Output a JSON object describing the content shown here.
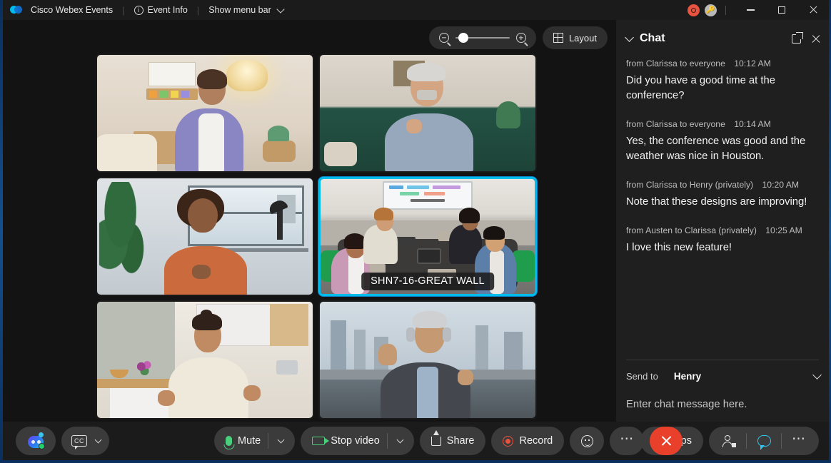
{
  "titlebar": {
    "app_name": "Cisco Webex Events",
    "event_info": "Event Info",
    "menu_bar": "Show menu bar",
    "recording_indicator": "recording-indicator",
    "host_key_indicator": "host-key-indicator",
    "minimize": "Minimize",
    "maximize": "Maximize",
    "close": "Close"
  },
  "stage": {
    "zoom_out_label": "Zoom out",
    "zoom_in_label": "Zoom in",
    "zoom_level": 12,
    "layout_label": "Layout",
    "tiles": [
      {
        "id": "tile-1",
        "name": "",
        "active": false,
        "scene": "bedroom-woman-purple"
      },
      {
        "id": "tile-2",
        "name": "",
        "active": false,
        "scene": "livingroom-man-gray-beard"
      },
      {
        "id": "tile-3",
        "name": "",
        "active": false,
        "scene": "office-woman-orange"
      },
      {
        "id": "tile-4",
        "name": "SHN7-16-GREAT WALL",
        "active": true,
        "scene": "conference-room-four-people"
      },
      {
        "id": "tile-5",
        "name": "",
        "active": false,
        "scene": "kitchen-woman-cream"
      },
      {
        "id": "tile-6",
        "name": "",
        "active": false,
        "scene": "city-man-headphones"
      }
    ]
  },
  "controls": {
    "assistant_label": "Webex AI Assistant",
    "captions_label": "CC",
    "mute": "Mute",
    "stop_video": "Stop video",
    "share": "Share",
    "record": "Record",
    "reactions_label": "Reactions",
    "more_label": "More options",
    "leave_label": "Leave meeting",
    "apps": "Apps",
    "participants_label": "Participants",
    "chat_label": "Chat",
    "more_right_label": "More options"
  },
  "chat": {
    "title": "Chat",
    "collapse_label": "Collapse",
    "popout_label": "Open in new window",
    "close_label": "Close chat",
    "messages": [
      {
        "meta": "from Clarissa to everyone",
        "time": "10:12 AM",
        "text": "Did you have a good time at the conference?"
      },
      {
        "meta": "from Clarissa to everyone",
        "time": "10:14 AM",
        "text": "Yes, the conference was good and the weather was nice in Houston."
      },
      {
        "meta": "from Clarissa to Henry (privately)",
        "time": "10:20 AM",
        "text": "Note that these designs are improving!"
      },
      {
        "meta": "from Austen to Clarissa (privately)",
        "time": "10:25 AM",
        "text": "I love this new feature!"
      }
    ],
    "send_to_label": "Send to",
    "send_to_value": "Henry",
    "input_placeholder": "Enter chat message here."
  },
  "colors": {
    "accent_cyan": "#00bceb",
    "active_border": "#00bceb",
    "danger_red": "#e8402a",
    "record_red": "#e8533f",
    "mic_green": "#4ad07d",
    "panel_bg": "#1f1f1f",
    "stage_bg": "#131313",
    "chrome_bg": "#1b1b1b"
  }
}
